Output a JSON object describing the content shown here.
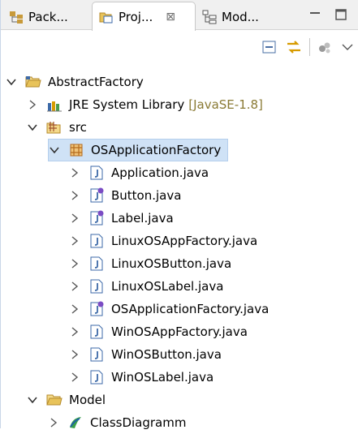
{
  "tabs": [
    {
      "label": "Pack...",
      "icon": "package-explorer-icon"
    },
    {
      "label": "Proj...",
      "icon": "project-explorer-icon",
      "active": true,
      "close_glyph": "⊠"
    },
    {
      "label": "Mod...",
      "icon": "model-explorer-icon"
    }
  ],
  "window_buttons": [
    "minimize-icon",
    "maximize-icon"
  ],
  "toolbar": [
    "collapse-all-icon",
    "link-with-editor-icon",
    "filters-icon",
    "view-menu-icon"
  ],
  "tree": {
    "project": "AbstractFactory",
    "jre": {
      "label": "JRE System Library",
      "decoration": "[JavaSE-1.8]"
    },
    "src": "src",
    "package": "OSApplicationFactory",
    "files": [
      {
        "name": "Application.java",
        "kind": "class"
      },
      {
        "name": "Button.java",
        "kind": "interface"
      },
      {
        "name": "Label.java",
        "kind": "interface"
      },
      {
        "name": "LinuxOSAppFactory.java",
        "kind": "class"
      },
      {
        "name": "LinuxOSButton.java",
        "kind": "class"
      },
      {
        "name": "LinuxOSLabel.java",
        "kind": "class"
      },
      {
        "name": "OSApplicationFactory.java",
        "kind": "interface"
      },
      {
        "name": "WinOSAppFactory.java",
        "kind": "class"
      },
      {
        "name": "WinOSButton.java",
        "kind": "class"
      },
      {
        "name": "WinOSLabel.java",
        "kind": "class"
      }
    ],
    "model_folder": "Model",
    "diagram": "ClassDiagramm"
  },
  "colors": {
    "selection": "#cfe2f6",
    "decoration": "#8a7a34",
    "folder": "#e8c35a",
    "java_file": "#3d6aa8",
    "interface": "#7b4cc4"
  }
}
